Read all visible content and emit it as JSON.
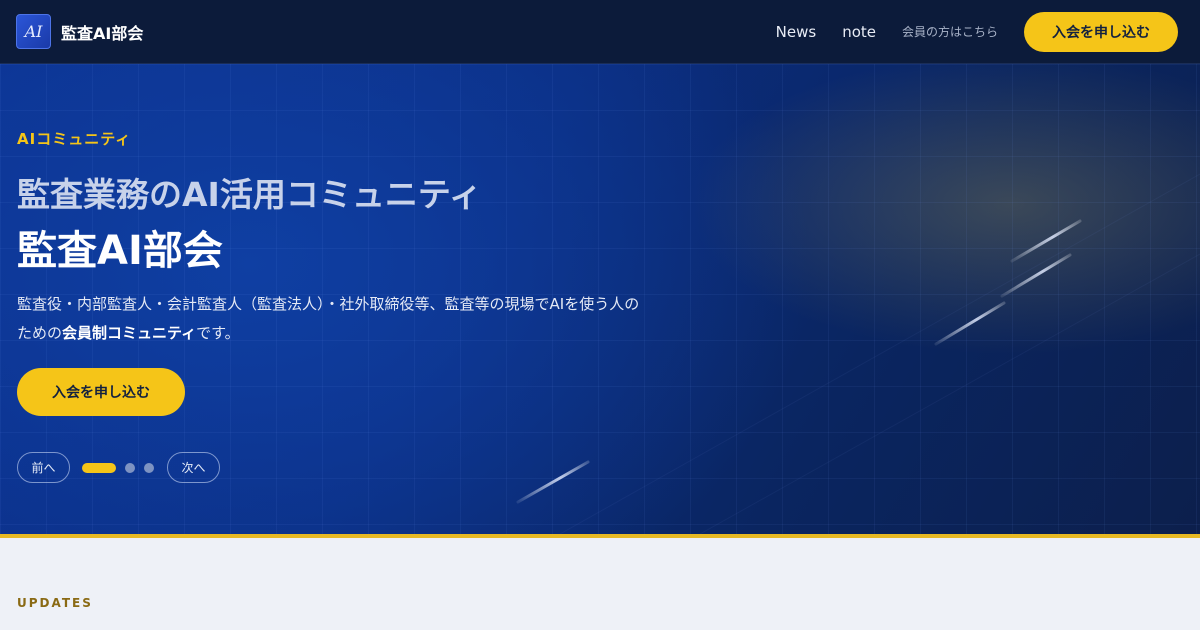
{
  "header": {
    "logo_text": "AI",
    "brand_name": "監査AI部会",
    "nav": [
      {
        "label": "News"
      },
      {
        "label": "note"
      },
      {
        "label": "会員の方はこちら"
      }
    ],
    "cta_label": "入会を申し込む"
  },
  "hero": {
    "eyebrow": "AIコミュニティ",
    "subtitle": "監査業務のAI活用コミュニティ",
    "title": "監査AI部会",
    "desc_line1": "監査役・内部監査人・会計監査人（監査法人）・社外取締役等、監査等の現場でAIを使う人の",
    "desc_line2_pre": "ための",
    "desc_line2_bold": "会員制コミュニティ",
    "desc_line2_post": "です。",
    "cta_label": "入会を申し込む",
    "pager": {
      "prev_label": "前へ",
      "next_label": "次へ",
      "slide_count": 3,
      "active_index": 0
    }
  },
  "updates_label": "UPDATES",
  "colors": {
    "accent": "#f5c518",
    "header_bg": "#0c1b3a",
    "hero_bg": "#0b2d80",
    "page_bg": "#eef1f7"
  }
}
